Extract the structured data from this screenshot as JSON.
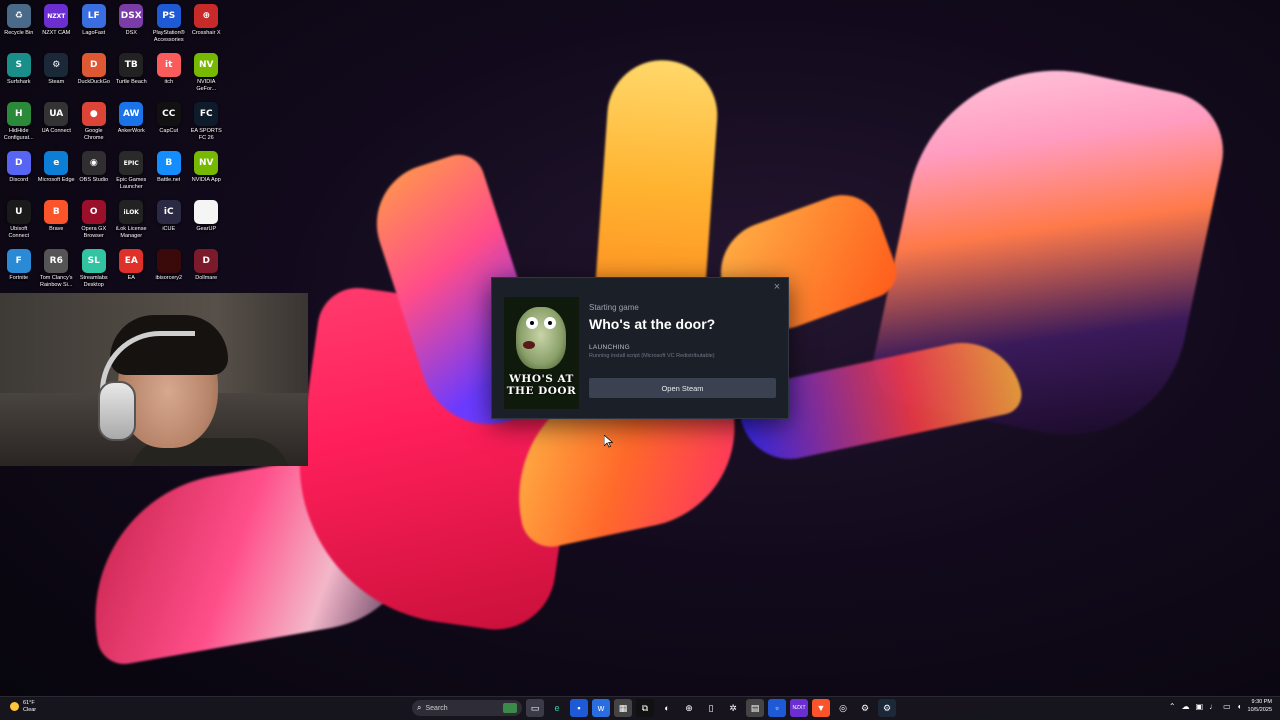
{
  "desktop_icons": [
    {
      "label": "Recycle Bin",
      "icon": "recycle-bin-icon",
      "abbr": "♻",
      "color": "#4a6a8a"
    },
    {
      "label": "NZXT CAM",
      "icon": "nzxt-cam-icon",
      "abbr": "NZXT",
      "color": "#6b2fd1"
    },
    {
      "label": "LagoFast",
      "icon": "lagofast-icon",
      "abbr": "LF",
      "color": "#3a6de0"
    },
    {
      "label": "DSX",
      "icon": "dsx-icon",
      "abbr": "DSX",
      "color": "#7b3ca8"
    },
    {
      "label": "PlayStation® Accessories",
      "icon": "playstation-icon",
      "abbr": "PS",
      "color": "#1f5ad6"
    },
    {
      "label": "Crosshair X",
      "icon": "crosshair-x-icon",
      "abbr": "⊕",
      "color": "#c82a2a"
    },
    {
      "label": "Surfshark",
      "icon": "surfshark-icon",
      "abbr": "S",
      "color": "#1a8f8a"
    },
    {
      "label": "Steam",
      "icon": "steam-icon",
      "abbr": "⚙",
      "color": "#1b2838"
    },
    {
      "label": "DuckDuckGo",
      "icon": "duckduckgo-icon",
      "abbr": "D",
      "color": "#de5833"
    },
    {
      "label": "Turtle Beach",
      "icon": "turtle-beach-icon",
      "abbr": "TB",
      "color": "#222"
    },
    {
      "label": "itch",
      "icon": "itch-icon",
      "abbr": "it",
      "color": "#fa5c5c"
    },
    {
      "label": "NVIDIA GeFor...",
      "icon": "nvidia-geforce-icon",
      "abbr": "NV",
      "color": "#76b900"
    },
    {
      "label": "HidHide Configurat...",
      "icon": "hidhide-icon",
      "abbr": "H",
      "color": "#2a8a3a"
    },
    {
      "label": "UA Connect",
      "icon": "ua-connect-icon",
      "abbr": "UA",
      "color": "#333"
    },
    {
      "label": "Google Chrome",
      "icon": "chrome-icon",
      "abbr": "●",
      "color": "#db4437"
    },
    {
      "label": "AnkerWork",
      "icon": "ankerwork-icon",
      "abbr": "AW",
      "color": "#1a73e8"
    },
    {
      "label": "CapCut",
      "icon": "capcut-icon",
      "abbr": "CC",
      "color": "#111"
    },
    {
      "label": "EA SPORTS FC 26",
      "icon": "ea-sports-fc-icon",
      "abbr": "FC",
      "color": "#0d1b2a"
    },
    {
      "label": "Discord",
      "icon": "discord-icon",
      "abbr": "D",
      "color": "#5865f2"
    },
    {
      "label": "Microsoft Edge",
      "icon": "edge-icon",
      "abbr": "e",
      "color": "#0c7ed6"
    },
    {
      "label": "OBS Studio",
      "icon": "obs-icon",
      "abbr": "◉",
      "color": "#302e31"
    },
    {
      "label": "Epic Games Launcher",
      "icon": "epic-games-icon",
      "abbr": "EPIC",
      "color": "#2a2a2a"
    },
    {
      "label": "Battle.net",
      "icon": "battlenet-icon",
      "abbr": "B",
      "color": "#148eff"
    },
    {
      "label": "NVIDIA App",
      "icon": "nvidia-app-icon",
      "abbr": "NV",
      "color": "#76b900"
    },
    {
      "label": "Ubisoft Connect",
      "icon": "ubisoft-icon",
      "abbr": "U",
      "color": "#1a1a1a"
    },
    {
      "label": "Brave",
      "icon": "brave-icon",
      "abbr": "B",
      "color": "#fb542b"
    },
    {
      "label": "Opera GX Browser",
      "icon": "opera-gx-icon",
      "abbr": "O",
      "color": "#9a0f2a"
    },
    {
      "label": "iLok License Manager",
      "icon": "ilok-icon",
      "abbr": "iLOK",
      "color": "#222"
    },
    {
      "label": "iCUE",
      "icon": "icue-icon",
      "abbr": "iC",
      "color": "#2a2a44"
    },
    {
      "label": "GearUP",
      "icon": "gearup-icon",
      "abbr": "",
      "color": "#f5f5f5"
    },
    {
      "label": "Fortnite",
      "icon": "fortnite-icon",
      "abbr": "F",
      "color": "#2a8ad6"
    },
    {
      "label": "Tom Clancy's Rainbow Si...",
      "icon": "rainbow-six-icon",
      "abbr": "R6",
      "color": "#555"
    },
    {
      "label": "Streamlabs Desktop",
      "icon": "streamlabs-icon",
      "abbr": "SL",
      "color": "#31c3a2"
    },
    {
      "label": "EA",
      "icon": "ea-icon",
      "abbr": "EA",
      "color": "#e0302a"
    },
    {
      "label": "ibisorcery2",
      "icon": "ibisorcery-icon",
      "abbr": "",
      "color": "#3a0a0a"
    },
    {
      "label": "Dollmare",
      "icon": "dollmare-icon",
      "abbr": "D",
      "color": "#7a1a2a"
    }
  ],
  "steam_popup": {
    "subtitle": "Starting game",
    "title": "Who's at the door?",
    "status": "LAUNCHING",
    "status_detail": "Running install script (Microsoft VC Redistributable)",
    "button": "Open Steam",
    "close": "×",
    "cover_text": "WHO'S AT THE DOOR"
  },
  "taskbar": {
    "weather_temp": "61°F",
    "weather_cond": "Clear",
    "search_placeholder": "Search",
    "time": "9:30 PM",
    "date": "10/5/2025"
  },
  "colors": {
    "popup_bg": "#1b1f27",
    "button_bg": "#3a4150",
    "start_accent": "#4cc2ff"
  }
}
